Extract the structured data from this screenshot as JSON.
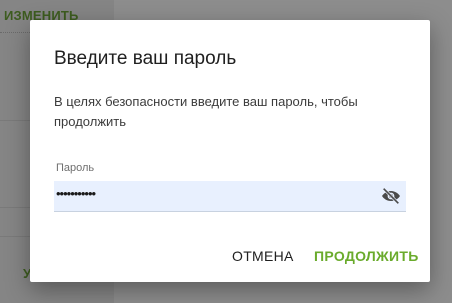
{
  "background": {
    "top_link": "ИЗМЕНИТЬ",
    "bottom_link": "У"
  },
  "dialog": {
    "title": "Введите ваш пароль",
    "description": "В целях безопасности введите ваш пароль, чтобы продолжить",
    "password_label": "Пароль",
    "password_value": "•••••••••••",
    "toggle_icon": "eye-off-icon",
    "cancel_label": "ОТМЕНА",
    "continue_label": "ПРОДОЛЖИТЬ"
  },
  "colors": {
    "accent": "#6aab2c",
    "field_bg": "#e8f0fe"
  }
}
